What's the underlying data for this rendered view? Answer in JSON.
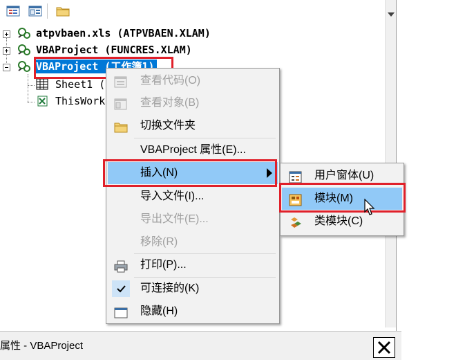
{
  "tree": {
    "items": [
      {
        "name": "atpvbaen.xls (ATPVBAEN.XLAM)",
        "bold": true
      },
      {
        "name": "VBAProject (FUNCRES.XLAM)",
        "bold": true
      },
      {
        "name": "VBAProject (工作簿1)",
        "bold": true,
        "selected": true
      },
      {
        "name": "Sheet1 (",
        "bold": false
      },
      {
        "name": "ThisWork",
        "bold": false
      }
    ]
  },
  "context_menu": {
    "items": [
      {
        "label": "查看代码(O)",
        "disabled": true,
        "icon": "code-icon"
      },
      {
        "label": "查看对象(B)",
        "disabled": true,
        "icon": "object-icon"
      },
      {
        "label": "切换文件夹",
        "disabled": false,
        "icon": "folder-icon"
      },
      {
        "label": "VBAProject 属性(E)...",
        "disabled": false,
        "icon": ""
      },
      {
        "label": "插入(N)",
        "disabled": false,
        "icon": "",
        "submenu": true,
        "highlighted": true
      },
      {
        "label": "导入文件(I)...",
        "disabled": false,
        "icon": ""
      },
      {
        "label": "导出文件(E)...",
        "disabled": true,
        "icon": ""
      },
      {
        "label": "移除(R)",
        "disabled": true,
        "icon": ""
      },
      {
        "label": "打印(P)...",
        "disabled": false,
        "icon": "printer-icon"
      },
      {
        "label": "可连接的(K)",
        "disabled": false,
        "icon": "checkmark-icon",
        "checked": true
      },
      {
        "label": "隐藏(H)",
        "disabled": false,
        "icon": "window-icon"
      }
    ]
  },
  "submenu": {
    "items": [
      {
        "label": "用户窗体(U)",
        "icon": "userform-icon"
      },
      {
        "label": "模块(M)",
        "icon": "module-icon",
        "highlighted": true
      },
      {
        "label": "类模块(C)",
        "icon": "class-module-icon"
      }
    ]
  },
  "statusbar": {
    "title": "属性 - VBAProject"
  },
  "colors": {
    "selection": "#0078d7",
    "menu_highlight": "#91c9f7",
    "annotation_red": "#e0202a"
  }
}
